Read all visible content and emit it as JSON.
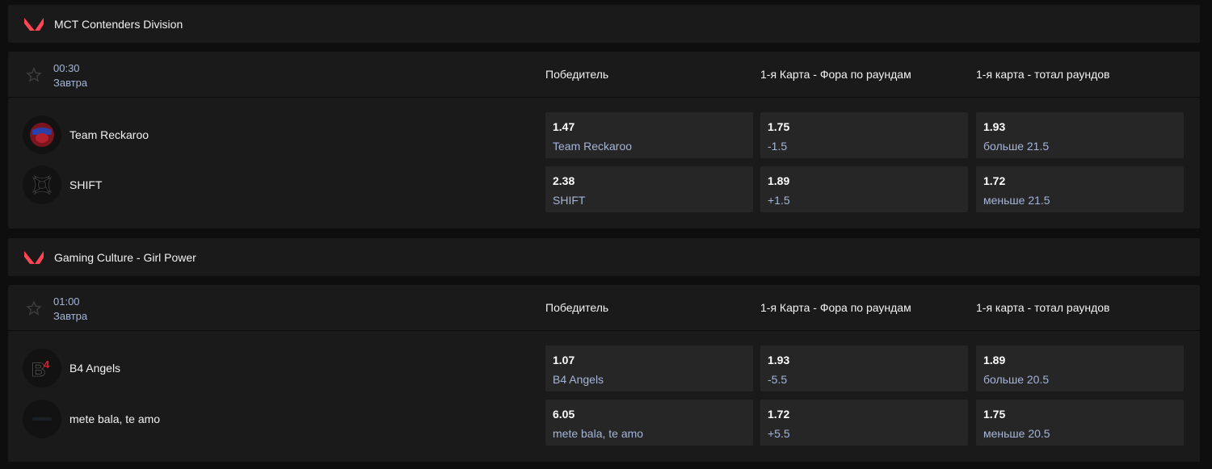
{
  "leagues": [
    {
      "name": "MCT Contenders Division",
      "event": {
        "time": "00:30",
        "day": "Завтра",
        "columns": [
          "Победитель",
          "1-я Карта - Фора по раундам",
          "1-я карта - тотал раундов"
        ],
        "teams": [
          {
            "name": "Team Reckaroo",
            "logo": "reckaroo-logo"
          },
          {
            "name": "SHIFT",
            "logo": "shift-logo"
          }
        ],
        "odds": [
          [
            {
              "coef": "1.47",
              "label": "Team Reckaroo"
            },
            {
              "coef": "1.75",
              "label": "-1.5"
            },
            {
              "coef": "1.93",
              "label": "больше 21.5"
            }
          ],
          [
            {
              "coef": "2.38",
              "label": "SHIFT"
            },
            {
              "coef": "1.89",
              "label": "+1.5"
            },
            {
              "coef": "1.72",
              "label": "меньше 21.5"
            }
          ]
        ]
      }
    },
    {
      "name": "Gaming Culture - Girl Power",
      "event": {
        "time": "01:00",
        "day": "Завтра",
        "columns": [
          "Победитель",
          "1-я Карта - Фора по раундам",
          "1-я карта - тотал раундов"
        ],
        "teams": [
          {
            "name": "B4 Angels",
            "logo": "b4-logo"
          },
          {
            "name": "mete bala, te amo",
            "logo": "placeholder-logo"
          }
        ],
        "odds": [
          [
            {
              "coef": "1.07",
              "label": "B4 Angels"
            },
            {
              "coef": "1.93",
              "label": "-5.5"
            },
            {
              "coef": "1.89",
              "label": "больше 20.5"
            }
          ],
          [
            {
              "coef": "6.05",
              "label": "mete bala, te amo"
            },
            {
              "coef": "1.72",
              "label": "+5.5"
            },
            {
              "coef": "1.75",
              "label": "меньше 20.5"
            }
          ]
        ]
      }
    }
  ],
  "colors": {
    "accent": "#ff4655",
    "muted": "#a4b5d9",
    "panel": "#1a1a1a",
    "cell": "#262626"
  },
  "icons": {
    "league": "valorant-icon",
    "favorite": "star-icon"
  }
}
